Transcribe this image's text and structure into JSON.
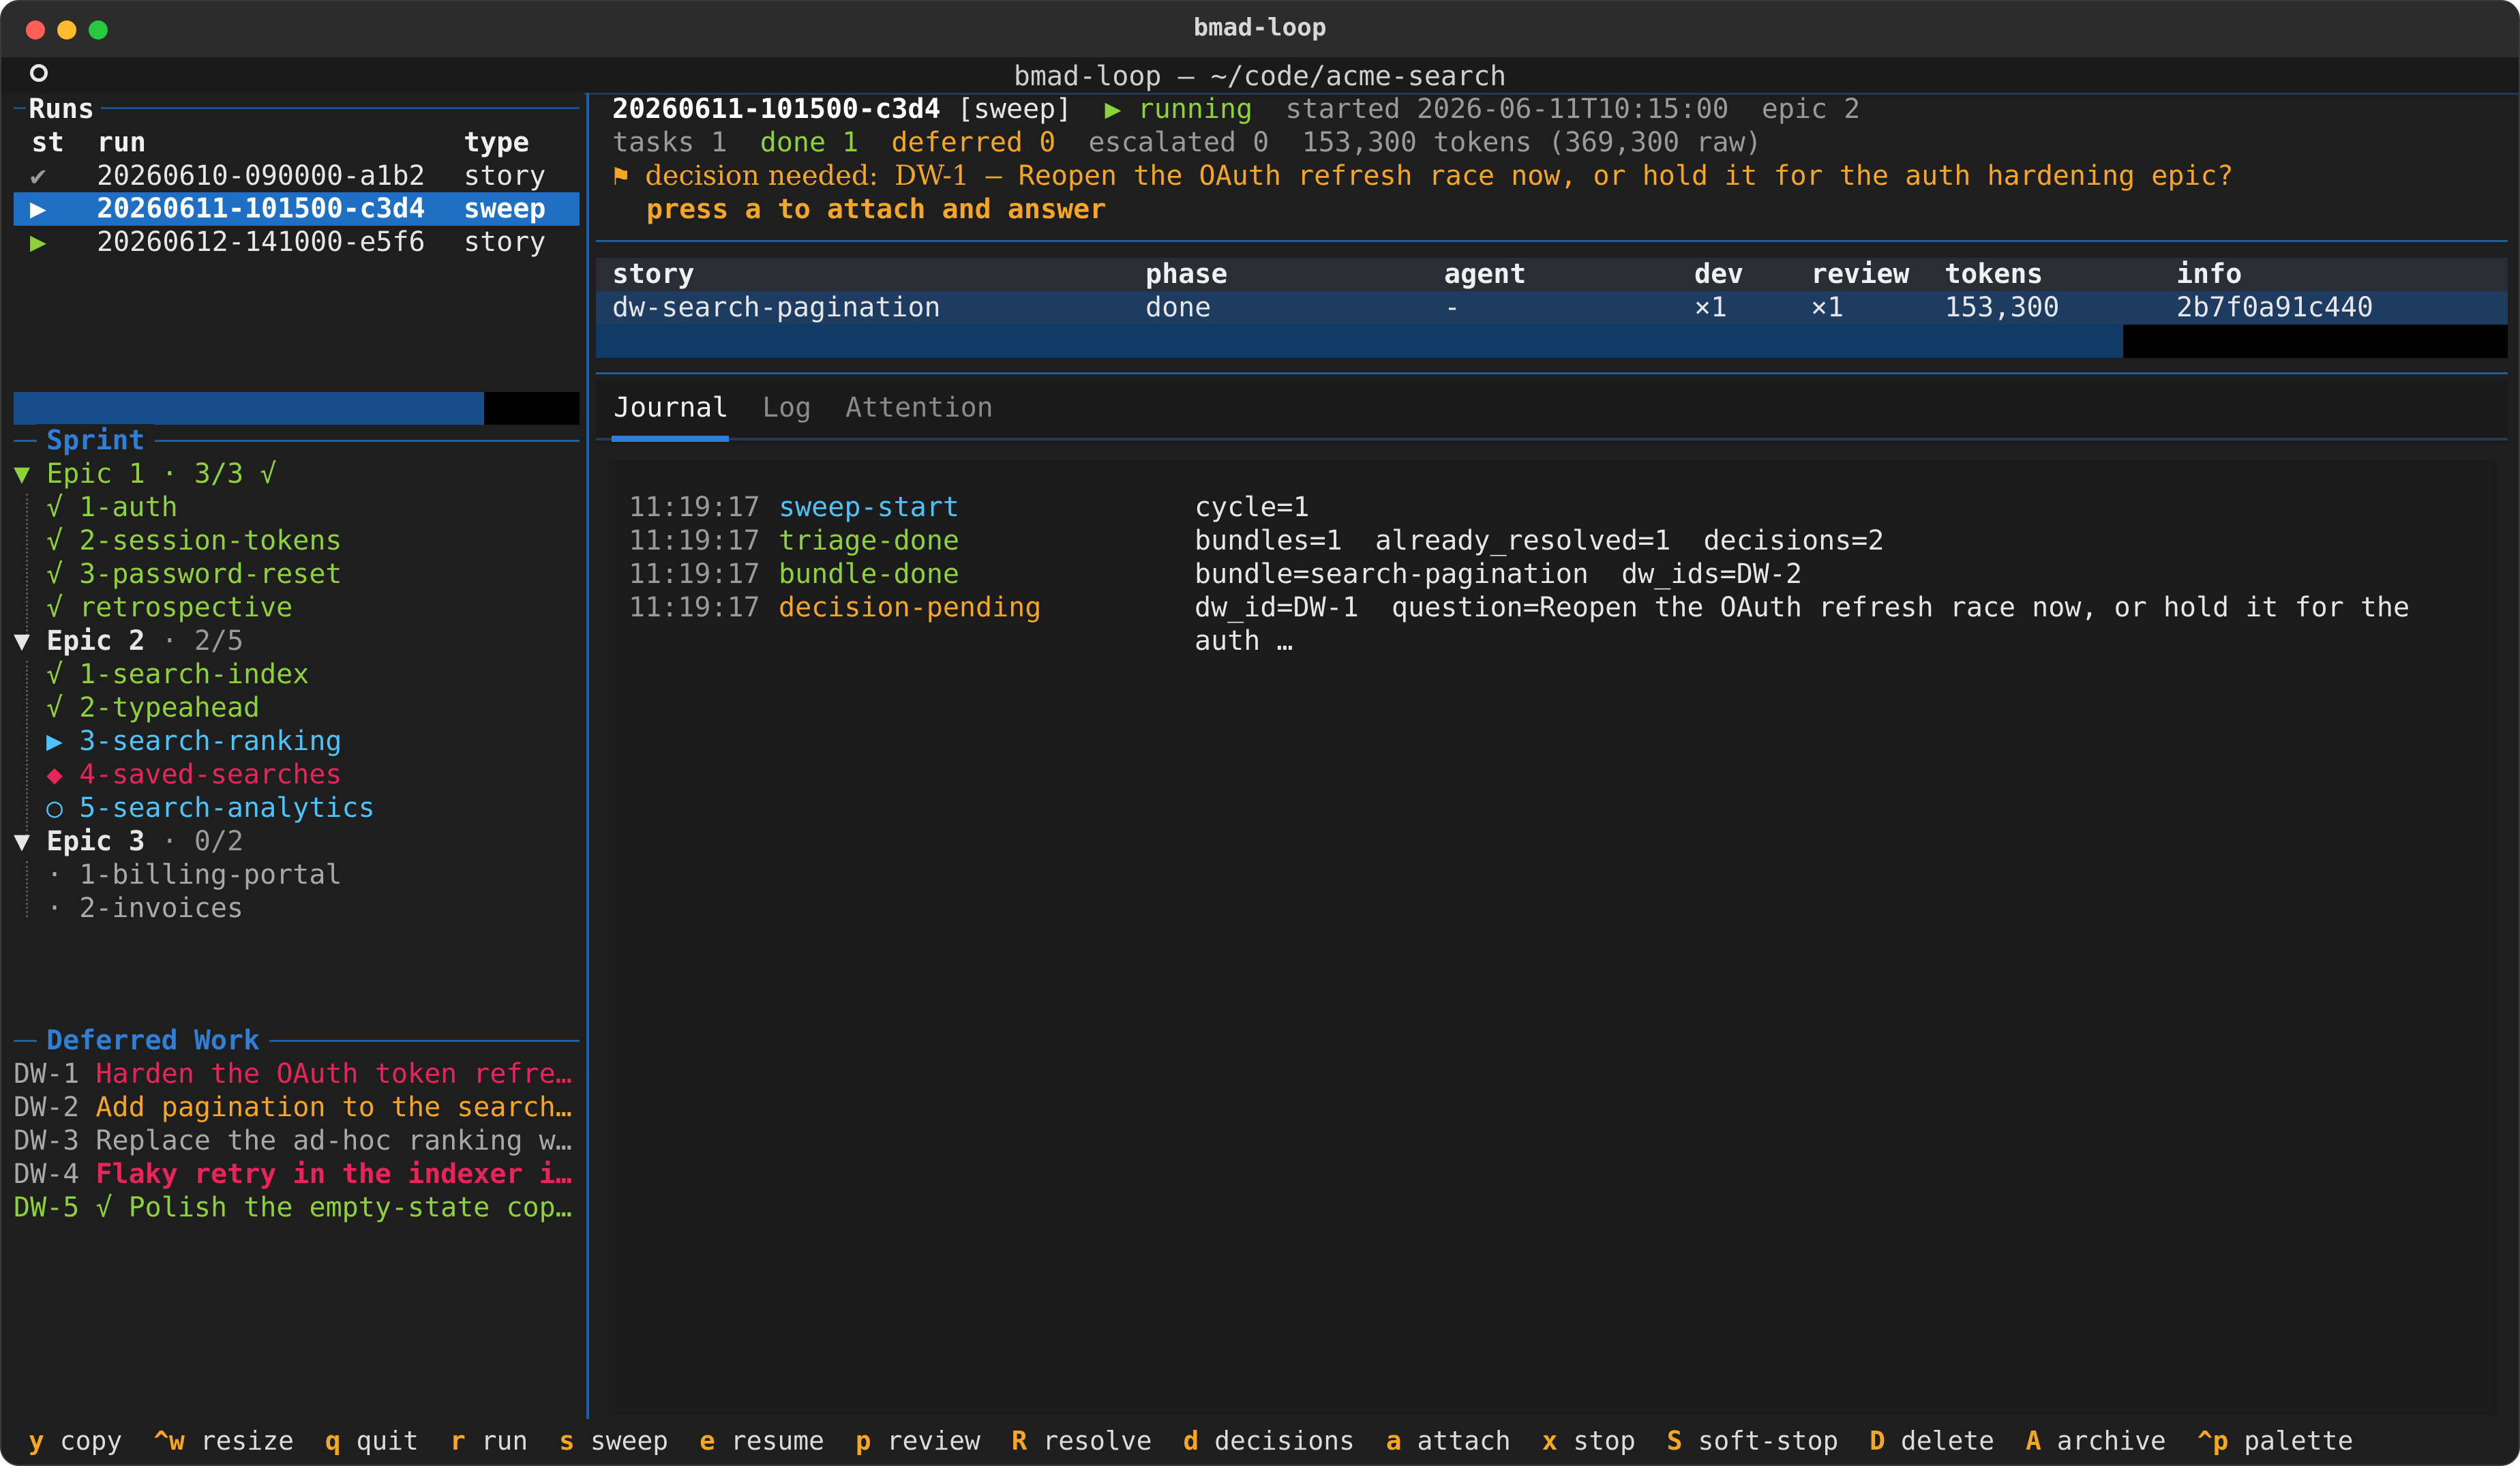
{
  "window": {
    "title": "bmad-loop"
  },
  "terminal": {
    "title": "bmad-loop — ~/code/acme-search"
  },
  "runs": {
    "title": "Runs",
    "headers": [
      "st",
      "run",
      "type"
    ],
    "rows": [
      {
        "st": "✔",
        "run": "20260610-090000-a1b2",
        "type": "story"
      },
      {
        "st": "▶",
        "run": "20260611-101500-c3d4",
        "type": "sweep"
      },
      {
        "st": "▶",
        "run": "20260612-141000-e5f6",
        "type": "story"
      }
    ]
  },
  "sprint": {
    "title": "Sprint",
    "epics": [
      {
        "label": "▼ Epic 1 · 3/3 √",
        "items": [
          {
            "mark": "√",
            "label": "1-auth"
          },
          {
            "mark": "√",
            "label": "2-session-tokens"
          },
          {
            "mark": "√",
            "label": "3-password-reset"
          },
          {
            "mark": "√",
            "label": "retrospective"
          }
        ]
      },
      {
        "label_a": "Epic 2",
        "label_b": " · 2/5",
        "items": [
          {
            "mark": "√",
            "label": "1-search-index"
          },
          {
            "mark": "√",
            "label": "2-typeahead"
          },
          {
            "mark": "▶",
            "label": "3-search-ranking"
          },
          {
            "mark": "◆",
            "label": "4-saved-searches"
          },
          {
            "mark": "○",
            "label": "5-search-analytics"
          }
        ]
      },
      {
        "label_a": "Epic 3",
        "label_b": " · 0/2",
        "items": [
          {
            "mark": "·",
            "label": "1-billing-portal"
          },
          {
            "mark": "·",
            "label": "2-invoices"
          }
        ]
      }
    ]
  },
  "deferred": {
    "title": "Deferred Work",
    "items": [
      {
        "id": "DW-1",
        "text": "Harden the OAuth token refre…"
      },
      {
        "id": "DW-2",
        "text": "Add pagination to the search…"
      },
      {
        "id": "DW-3",
        "text": "Replace the ad-hoc ranking w…"
      },
      {
        "id": "DW-4",
        "text": "Flaky retry in the indexer i…"
      },
      {
        "id": "DW-5",
        "text": "√ Polish the empty-state cop…"
      }
    ]
  },
  "run_detail": {
    "run_id": "20260611-101500-c3d4",
    "type": "[sweep]",
    "status": "▶ running",
    "started": "started 2026-06-11T10:15:00",
    "epic": "epic 2",
    "tasks": "tasks 1",
    "done": "done 1",
    "deferred": "deferred 0",
    "escalated": "escalated 0",
    "tokens": "153,300 tokens (369,300 raw)",
    "decision_flag": "⚑",
    "decision_prefix": "decision needed:",
    "decision_id": "DW-1",
    "decision_text": " — Reopen the OAuth refresh race now, or hold it for the auth hardening epic?",
    "attach_hint": "press a to attach and answer"
  },
  "stories_table": {
    "headers": [
      "story",
      "phase",
      "agent",
      "dev",
      "review",
      "tokens",
      "info"
    ],
    "rows": [
      [
        "dw-search-pagination",
        "done",
        "-",
        "×1",
        "×1",
        "153,300",
        "2b7f0a91c440"
      ]
    ]
  },
  "tabs": [
    "Journal",
    "Log",
    "Attention"
  ],
  "journal": [
    {
      "time": "11:19:17",
      "event": "sweep-start",
      "detail": "cycle=1"
    },
    {
      "time": "11:19:17",
      "event": "triage-done",
      "detail": "bundles=1  already_resolved=1  decisions=2"
    },
    {
      "time": "11:19:17",
      "event": "bundle-done",
      "detail": "bundle=search-pagination  dw_ids=DW-2"
    },
    {
      "time": "11:19:17",
      "event": "decision-pending",
      "detail": "dw_id=DW-1  question=Reopen the OAuth refresh race now, or hold it for the",
      "detail2": "auth …"
    }
  ],
  "footer": [
    {
      "key": "y",
      "label": "copy"
    },
    {
      "key": "^w",
      "label": "resize"
    },
    {
      "key": "q",
      "label": "quit"
    },
    {
      "key": "r",
      "label": "run"
    },
    {
      "key": "s",
      "label": "sweep"
    },
    {
      "key": "e",
      "label": "resume"
    },
    {
      "key": "p",
      "label": "review"
    },
    {
      "key": "R",
      "label": "resolve"
    },
    {
      "key": "d",
      "label": "decisions"
    },
    {
      "key": "a",
      "label": "attach"
    },
    {
      "key": "x",
      "label": "stop"
    },
    {
      "key": "S",
      "label": "soft-stop"
    },
    {
      "key": "D",
      "label": "delete"
    },
    {
      "key": "A",
      "label": "archive"
    },
    {
      "key": "^p",
      "label": "palette"
    }
  ],
  "colors": {
    "accent_blue": "#2f7fd6",
    "green": "#8fd13a",
    "cyan": "#4fc3f7",
    "orange": "#f5a623",
    "red": "#e8245a",
    "grey": "#a8a8a8"
  }
}
